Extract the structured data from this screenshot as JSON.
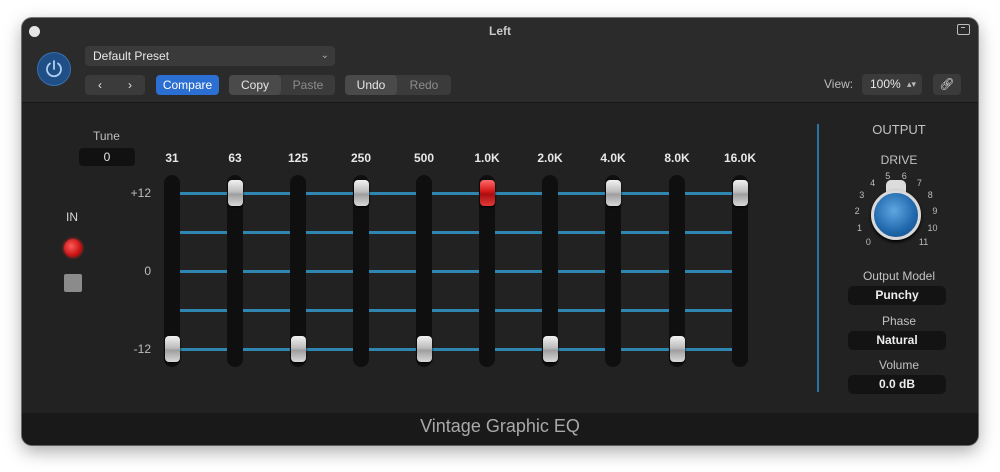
{
  "window": {
    "title": "Left"
  },
  "toolbar": {
    "preset": "Default Preset",
    "compare": "Compare",
    "copy": "Copy",
    "paste": "Paste",
    "undo": "Undo",
    "redo": "Redo",
    "view_label": "View:",
    "zoom": "100%"
  },
  "eq": {
    "tune_label": "Tune",
    "tune_value": "0",
    "in_label": "IN",
    "y_ticks": [
      "+12",
      "0",
      "-12"
    ],
    "bands": [
      {
        "label": "31",
        "gain_db": -12
      },
      {
        "label": "63",
        "gain_db": 12
      },
      {
        "label": "125",
        "gain_db": -12
      },
      {
        "label": "250",
        "gain_db": 12
      },
      {
        "label": "500",
        "gain_db": -12
      },
      {
        "label": "1.0K",
        "gain_db": 12,
        "selected": true
      },
      {
        "label": "2.0K",
        "gain_db": -12
      },
      {
        "label": "4.0K",
        "gain_db": 12
      },
      {
        "label": "8.0K",
        "gain_db": -12
      },
      {
        "label": "16.0K",
        "gain_db": 12
      }
    ]
  },
  "output": {
    "title": "OUTPUT",
    "drive_label": "DRIVE",
    "drive_scale": [
      "0",
      "1",
      "2",
      "3",
      "4",
      "5",
      "6",
      "7",
      "8",
      "9",
      "10",
      "11"
    ],
    "drive_value": 5,
    "model_label": "Output Model",
    "model_value": "Punchy",
    "phase_label": "Phase",
    "phase_value": "Natural",
    "volume_label": "Volume",
    "volume_value": "0.0 dB"
  },
  "footer": {
    "plugin_name": "Vintage Graphic EQ"
  },
  "colors": {
    "accent": "#2a6fd1",
    "eq_line": "#2f86b1",
    "led_on": "#e31b1b"
  }
}
